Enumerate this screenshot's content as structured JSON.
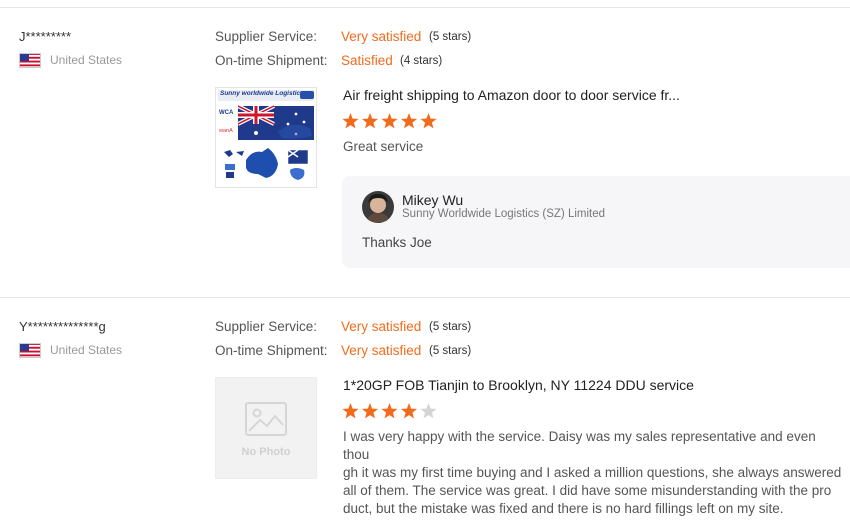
{
  "colors": {
    "accent": "#f26b1d",
    "star_filled": "#f26b1d",
    "star_empty": "#d4d4d4"
  },
  "reviews": [
    {
      "buyer": "J*********",
      "country": "United States",
      "flag_icon": "us-flag-icon",
      "supplier_service_label": "Supplier Service:",
      "supplier_service_value": "Very satisfied",
      "supplier_service_stars": "(5 stars)",
      "shipment_label": "On-time Shipment:",
      "shipment_value": "Satisfied",
      "shipment_stars": "(4 stars)",
      "product_image_brand": "Sunny worldwide Logistics",
      "product_image_logos": [
        "WCA",
        "wanA"
      ],
      "product_title": "Air freight shipping to Amazon door to door service fr...",
      "rating": 5,
      "review": "Great service",
      "reply": {
        "name": "Mikey Wu",
        "company": "Sunny Worldwide Logistics (SZ) Limited",
        "text": "Thanks Joe"
      }
    },
    {
      "buyer": "Y**************g",
      "country": "United States",
      "flag_icon": "us-flag-icon",
      "supplier_service_label": "Supplier Service:",
      "supplier_service_value": "Very satisfied",
      "supplier_service_stars": "(5 stars)",
      "shipment_label": "On-time Shipment:",
      "shipment_value": "Very satisfied",
      "shipment_stars": "(5 stars)",
      "no_photo_text": "No Photo",
      "product_title": "1*20GP FOB Tianjin to Brooklyn, NY 11224 DDU service",
      "rating": 4,
      "review_lines": [
        "I was very happy with the service. Daisy was my sales representative and even thou",
        "gh it was my first time buying and I asked a million questions, she always answered",
        "all of them. The service was great. I did have some misunderstanding with the pro",
        "duct, but the mistake was fixed and there is no hard fillings left on my site."
      ]
    }
  ]
}
